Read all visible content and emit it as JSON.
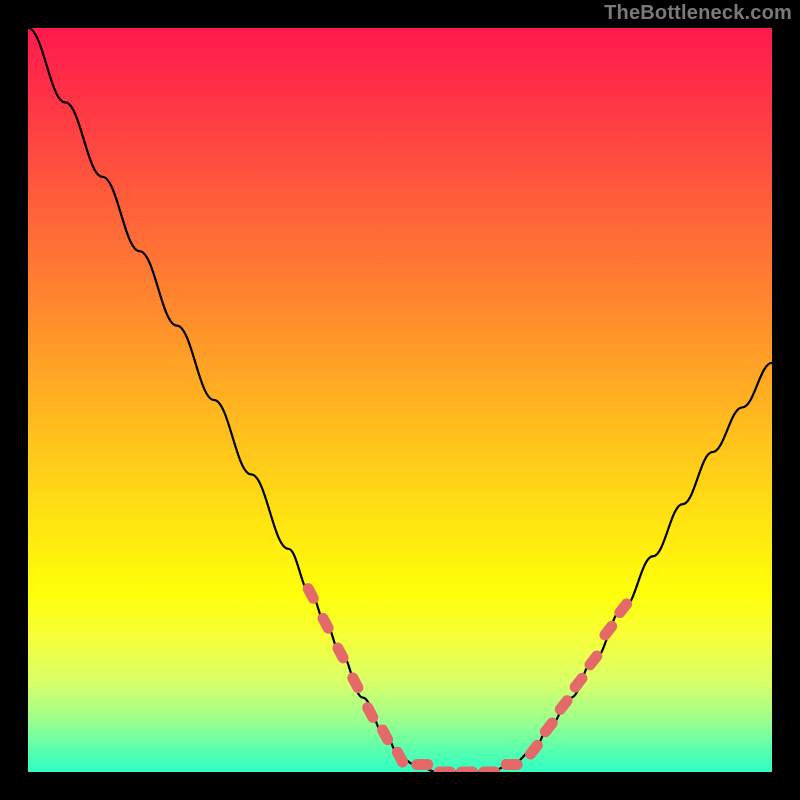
{
  "watermark": "TheBottleneck.com",
  "colors": {
    "page_bg": "#000000",
    "gradient_stops": [
      "#ff1a4d",
      "#ff2f47",
      "#ff5a3b",
      "#ff8a2e",
      "#ffb81f",
      "#ffe312",
      "#ffff0a",
      "#f6ff3a",
      "#d8ff6a",
      "#9cff8c",
      "#5affad",
      "#2fffc4"
    ],
    "curve": "#000000",
    "markers": "#e46a6a"
  },
  "chart_data": {
    "type": "line",
    "title": "",
    "xlabel": "",
    "ylabel": "",
    "xlim": [
      0,
      100
    ],
    "ylim": [
      0,
      100
    ],
    "series": [
      {
        "name": "bottleneck-curve",
        "x": [
          0,
          5,
          10,
          15,
          20,
          25,
          30,
          35,
          38,
          40,
          42,
          45,
          48,
          50,
          52,
          55,
          58,
          60,
          62,
          65,
          68,
          70,
          73,
          76,
          80,
          84,
          88,
          92,
          96,
          100
        ],
        "y": [
          100,
          90,
          80,
          70,
          60,
          50,
          40,
          30,
          24,
          20,
          16,
          10,
          5,
          2,
          1,
          0,
          0,
          0,
          0,
          1,
          3,
          6,
          10,
          15,
          22,
          29,
          36,
          43,
          49,
          55
        ]
      }
    ],
    "markers": [
      {
        "name": "left-dot-1",
        "x": 38,
        "y": 24
      },
      {
        "name": "left-dot-2",
        "x": 40,
        "y": 20
      },
      {
        "name": "left-dot-3",
        "x": 42,
        "y": 16
      },
      {
        "name": "left-dot-4",
        "x": 44,
        "y": 12
      },
      {
        "name": "left-dot-5",
        "x": 46,
        "y": 8
      },
      {
        "name": "left-dot-6",
        "x": 48,
        "y": 5
      },
      {
        "name": "left-dot-7",
        "x": 50,
        "y": 2
      },
      {
        "name": "flat-dot-1",
        "x": 53,
        "y": 1
      },
      {
        "name": "flat-dot-2",
        "x": 56,
        "y": 0
      },
      {
        "name": "flat-dot-3",
        "x": 59,
        "y": 0
      },
      {
        "name": "flat-dot-4",
        "x": 62,
        "y": 0
      },
      {
        "name": "flat-dot-5",
        "x": 65,
        "y": 1
      },
      {
        "name": "right-dot-1",
        "x": 68,
        "y": 3
      },
      {
        "name": "right-dot-2",
        "x": 70,
        "y": 6
      },
      {
        "name": "right-dot-3",
        "x": 72,
        "y": 9
      },
      {
        "name": "right-dot-4",
        "x": 74,
        "y": 12
      },
      {
        "name": "right-dot-5",
        "x": 76,
        "y": 15
      },
      {
        "name": "right-dot-6",
        "x": 78,
        "y": 19
      },
      {
        "name": "right-dot-7",
        "x": 80,
        "y": 22
      }
    ]
  }
}
